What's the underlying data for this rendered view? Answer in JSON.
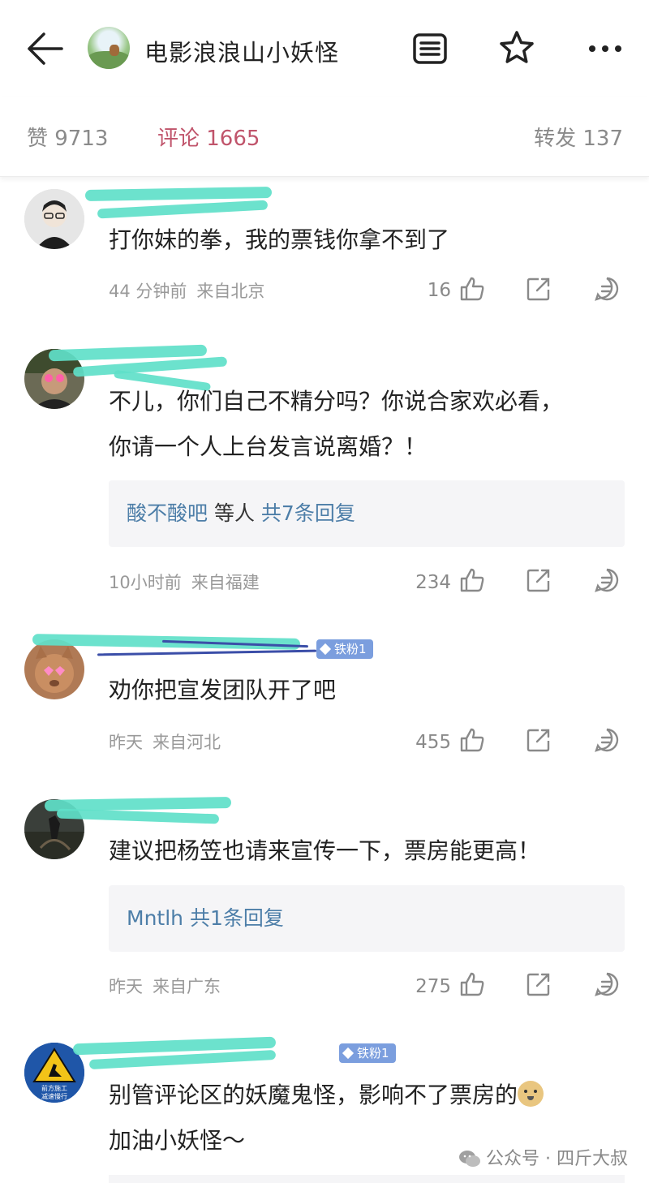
{
  "header": {
    "title": "电影浪浪山小妖怪"
  },
  "tabs": {
    "likes": "赞 9713",
    "comments": "评论 1665",
    "reposts": "转发 137"
  },
  "comments": [
    {
      "username": "",
      "content_lines": [
        "打你妹的拳，我的票钱你拿不到了"
      ],
      "time": "44 分钟前",
      "location": "来自北京",
      "likes": "16"
    },
    {
      "username": "",
      "content_lines": [
        "不儿，你们自己不精分吗？你说合家欢必看，",
        "你请一个人上台发言说离婚？！"
      ],
      "reply": {
        "name": "酸不酸吧",
        "text": " 等人 ",
        "count": "共7条回复"
      },
      "time": "10小时前",
      "location": "来自福建",
      "likes": "234"
    },
    {
      "username": "",
      "badge": "铁粉1",
      "content_lines": [
        "劝你把宣发团队开了吧"
      ],
      "time": "昨天",
      "location": "来自河北",
      "likes": "455"
    },
    {
      "username": "",
      "content_lines": [
        "建议把杨笠也请来宣传一下，票房能更高！"
      ],
      "reply": {
        "name": "Mntlh",
        "text": " ",
        "count": "共1条回复"
      },
      "time": "昨天",
      "location": "来自广东",
      "likes": "275"
    },
    {
      "username": "",
      "badge": "铁粉1",
      "avatar_text": [
        "前方施工",
        "减速慢行"
      ],
      "content_lines": [
        "别管评论区的妖魔鬼怪，影响不了票房的",
        "加油小妖怪～"
      ]
    }
  ],
  "watermark": "公众号 · 四斤大叔",
  "icons": {
    "back": "back-arrow-icon",
    "menu": "list-icon",
    "star": "star-icon",
    "more": "more-icon",
    "like": "thumb-up-icon",
    "share": "share-icon",
    "reply": "comment-icon"
  },
  "colors": {
    "accent": "#c0546b",
    "reply_link": "#4d7ea8",
    "badge": "#7b9ede",
    "scribble": "#5fe0c9"
  }
}
